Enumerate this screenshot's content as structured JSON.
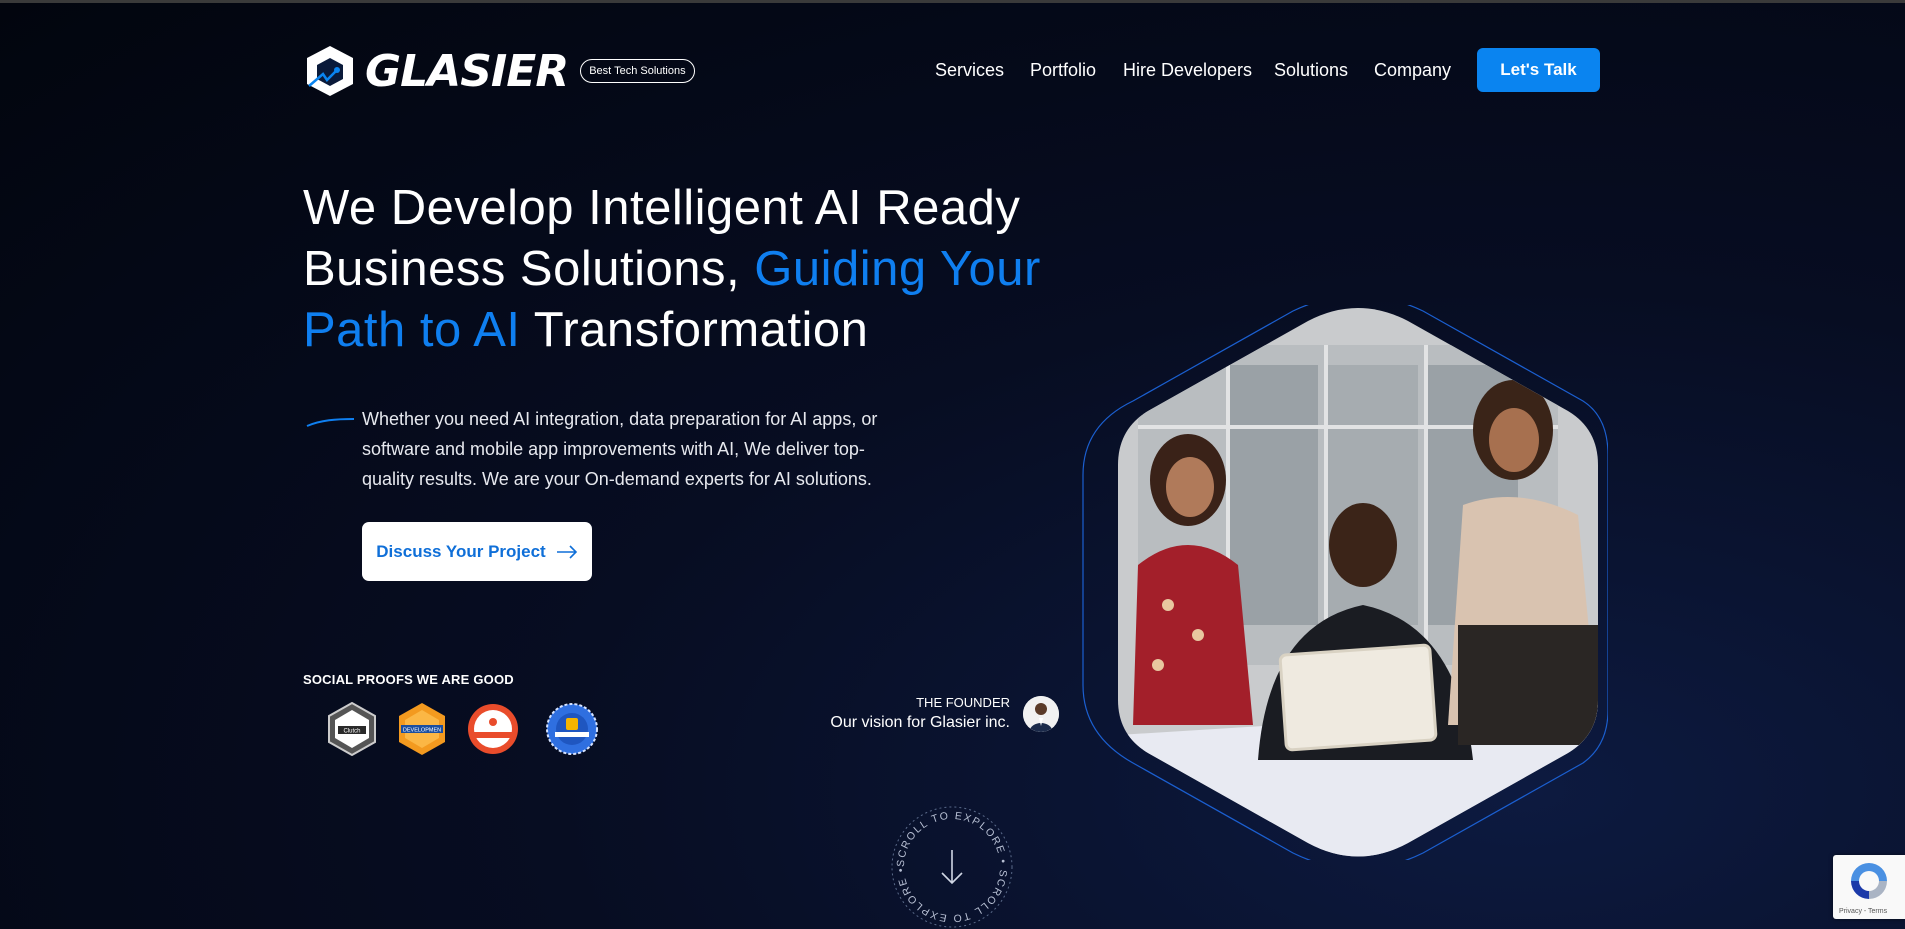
{
  "header": {
    "brand": "GLASIER",
    "badge": "Best Tech Solutions",
    "nav": [
      "Services",
      "Portfolio",
      "Hire Developers",
      "Solutions",
      "Company"
    ],
    "cta": "Let's Talk"
  },
  "hero": {
    "title_part1": "We Develop Intelligent AI Ready Business Solutions, ",
    "title_highlight": "Guiding Your Path to AI",
    "title_part2": " Transformation",
    "description": "Whether you need AI integration, data preparation for AI apps, or software and mobile app improvements with AI, We deliver top-quality results. We are your On-demand experts for AI solutions.",
    "button": "Discuss Your Project"
  },
  "social_proofs": {
    "label": "SOCIAL PROOFS WE ARE GOOD",
    "badges": [
      {
        "icon": "clutch-badge-icon",
        "text": "Clutch"
      },
      {
        "icon": "developer-badge-icon",
        "text": "DEVELOPMEN"
      },
      {
        "icon": "appfutura-badge-icon",
        "text": ""
      },
      {
        "icon": "goodfirms-badge-icon",
        "text": ""
      }
    ]
  },
  "founder": {
    "kicker": "THE FOUNDER",
    "text": "Our vision for Glasier inc."
  },
  "scroll": {
    "label": "SCROLL TO EXPLORE • SCROLL TO EXPLORE • "
  },
  "recaptcha": {
    "text": "Privacy - Terms"
  },
  "colors": {
    "accent": "#0f7ff0",
    "cta": "#0a84f0",
    "background": "#02050e"
  }
}
